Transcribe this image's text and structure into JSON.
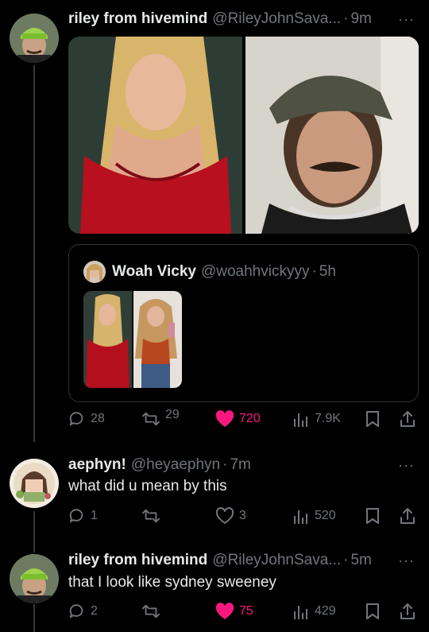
{
  "tweets": [
    {
      "name": "riley from hivemind",
      "handle": "@RileyJohnSava...",
      "time": "9m",
      "quote": {
        "name": "Woah Vicky",
        "handle": "@woahhvickyyy",
        "time": "5h"
      },
      "stats": {
        "replies": "28",
        "retweets": "29",
        "likes": "720",
        "views": "7.9K"
      },
      "liked": true
    },
    {
      "name": "aephyn!",
      "handle": "@heyaephyn",
      "time": "7m",
      "text": "what did u mean by this",
      "stats": {
        "replies": "1",
        "retweets": "",
        "likes": "3",
        "views": "520"
      },
      "liked": false
    },
    {
      "name": "riley from hivemind",
      "handle": "@RileyJohnSava...",
      "time": "5m",
      "text": "that I look like sydney sweeney",
      "stats": {
        "replies": "2",
        "retweets": "",
        "likes": "75",
        "views": "429"
      },
      "liked": true
    }
  ],
  "dot_separator": "·",
  "more_glyph": "···",
  "colors": {
    "background": "#000000",
    "text": "#e7e9ea",
    "muted": "#71767b",
    "like": "#f91880",
    "border": "#2f3336"
  },
  "icons": [
    "reply-icon",
    "retweet-icon",
    "heart-icon",
    "views-icon",
    "bookmark-icon",
    "share-icon",
    "more-icon"
  ]
}
